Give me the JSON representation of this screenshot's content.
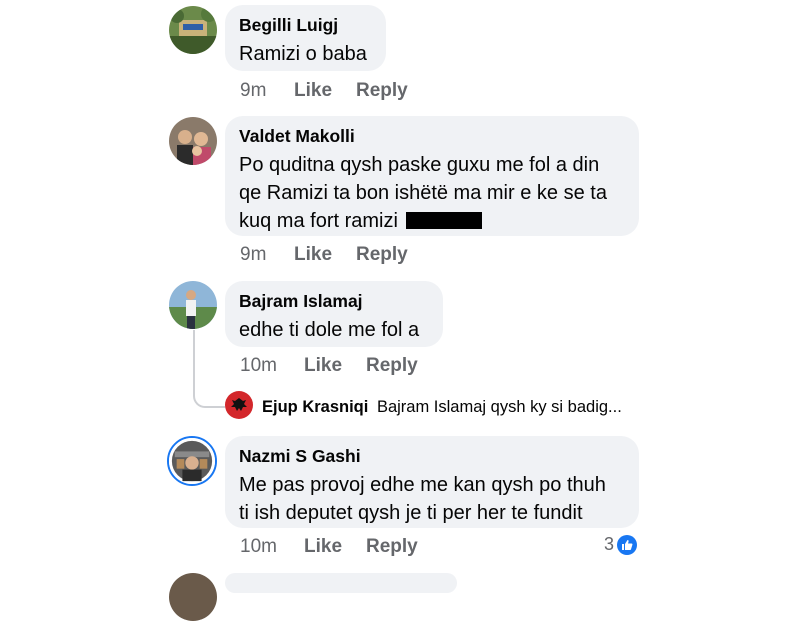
{
  "comments": [
    {
      "name": "Begilli Luigj",
      "text_lines": [
        "Ramizi o baba"
      ],
      "time": "9m",
      "like": "Like",
      "reply": "Reply"
    },
    {
      "name": "Valdet Makolli",
      "text_lines": [
        "Po quditna qysh paske guxu me fol a din",
        "qe Ramizi ta bon ishëtë ma mir e ke se ta",
        "kuq ma fort ramizi"
      ],
      "time": "9m",
      "like": "Like",
      "reply": "Reply"
    },
    {
      "name": "Bajram Islamaj",
      "text_lines": [
        "edhe ti dole me fol a"
      ],
      "time": "10m",
      "like": "Like",
      "reply": "Reply",
      "reply_preview": {
        "name": "Ejup Krasniqi",
        "text": "Bajram Islamaj qysh ky si badig..."
      }
    },
    {
      "name": "Nazmi S Gashi",
      "text_lines": [
        "Me pas provoj edhe me kan qysh po thuh",
        "ti ish deputet qysh je ti per her te fundit"
      ],
      "time": "10m",
      "like": "Like",
      "reply": "Reply",
      "reaction_count": "3",
      "reaction_icon": "like-thumb-icon"
    }
  ],
  "colors": {
    "bubble": "#f0f2f5",
    "secondary_text": "#65676b",
    "accent": "#1877f2"
  }
}
